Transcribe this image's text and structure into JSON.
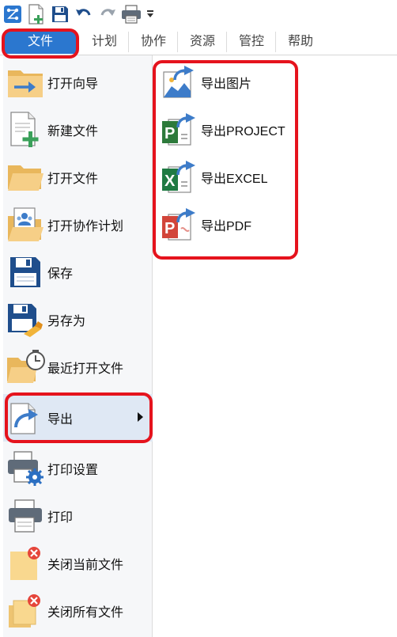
{
  "toolbar": {
    "icons": [
      "app-logo-icon",
      "new-file-icon",
      "save-icon",
      "undo-icon",
      "redo-icon",
      "print-icon",
      "customize-dropdown-icon"
    ]
  },
  "tabs": [
    {
      "label": "文件"
    },
    {
      "label": "计划"
    },
    {
      "label": "协作"
    },
    {
      "label": "资源"
    },
    {
      "label": "管控"
    },
    {
      "label": "帮助"
    }
  ],
  "menu": {
    "items": [
      {
        "label": "打开向导"
      },
      {
        "label": "新建文件"
      },
      {
        "label": "打开文件"
      },
      {
        "label": "打开协作计划"
      },
      {
        "label": "保存"
      },
      {
        "label": "另存为"
      },
      {
        "label": "最近打开文件"
      },
      {
        "label": "导出"
      },
      {
        "label": "打印设置"
      },
      {
        "label": "打印"
      },
      {
        "label": "关闭当前文件"
      },
      {
        "label": "关闭所有文件"
      }
    ]
  },
  "submenu": {
    "items": [
      {
        "label": "导出图片"
      },
      {
        "label": "导出PROJECT"
      },
      {
        "label": "导出EXCEL"
      },
      {
        "label": "导出PDF"
      }
    ]
  },
  "colors": {
    "accent": "#2b77cf",
    "highlight": "#e5131d",
    "folder": "#f3c877",
    "arrow_blue": "#3d7cc9"
  }
}
